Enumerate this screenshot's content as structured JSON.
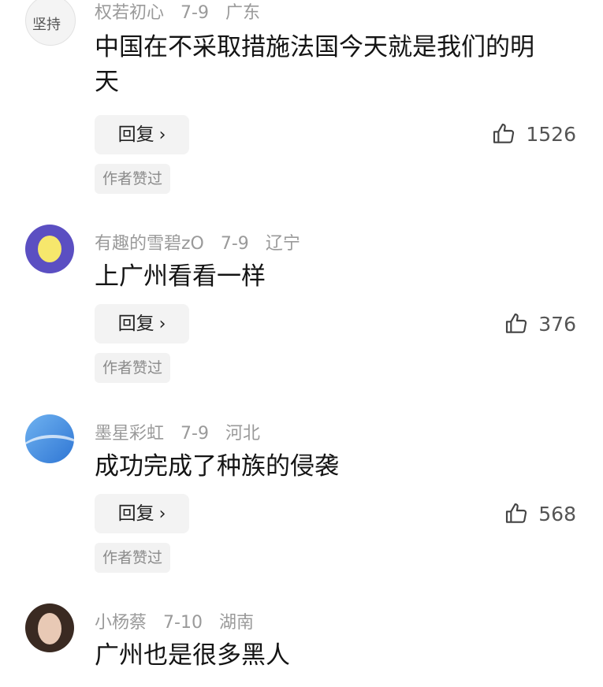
{
  "comments": [
    {
      "username": "权若初心",
      "date": "7-9",
      "location": "广东",
      "text": "中国在不采取措施法国今天就是我们的明天",
      "reply_label": "回复",
      "likes": "1526",
      "badge": "作者赞过",
      "avatar_text": "坚持"
    },
    {
      "username": "有趣的雪碧zO",
      "date": "7-9",
      "location": "辽宁",
      "text": "上广州看看一样",
      "reply_label": "回复",
      "likes": "376",
      "badge": "作者赞过"
    },
    {
      "username": "墨星彩虹",
      "date": "7-9",
      "location": "河北",
      "text": "成功完成了种族的侵袭",
      "reply_label": "回复",
      "likes": "568",
      "badge": "作者赞过"
    },
    {
      "username": "小杨蔡",
      "date": "7-10",
      "location": "湖南",
      "text": "广州也是很多黑人"
    }
  ],
  "icons": {
    "like": "thumbs-up-icon",
    "reply_chevron": "chevron-right-icon"
  },
  "colors": {
    "meta_text": "#9a9a9a",
    "reply_bg": "#f3f3f3",
    "badge_bg": "#f2f2f2"
  }
}
